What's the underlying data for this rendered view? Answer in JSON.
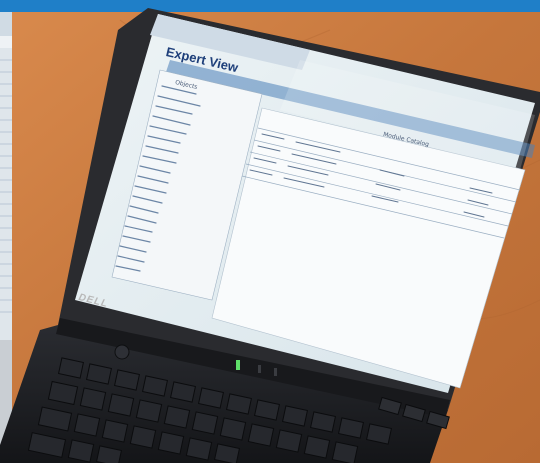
{
  "photo": {
    "subject": "laptop-computer",
    "surface": "wooden-desk",
    "colors": {
      "top_band": "#1f7fc8",
      "wood": "#c8773e",
      "laptop_body": "#1d1f24",
      "screen": "#e9f1f4",
      "left_window": "#dfe6eb"
    }
  },
  "screen_ui": {
    "view_title": "Expert View",
    "left_panel_header": "Objects",
    "grid_title": "Module Catalog"
  },
  "laptop": {
    "brand": "DELL"
  }
}
